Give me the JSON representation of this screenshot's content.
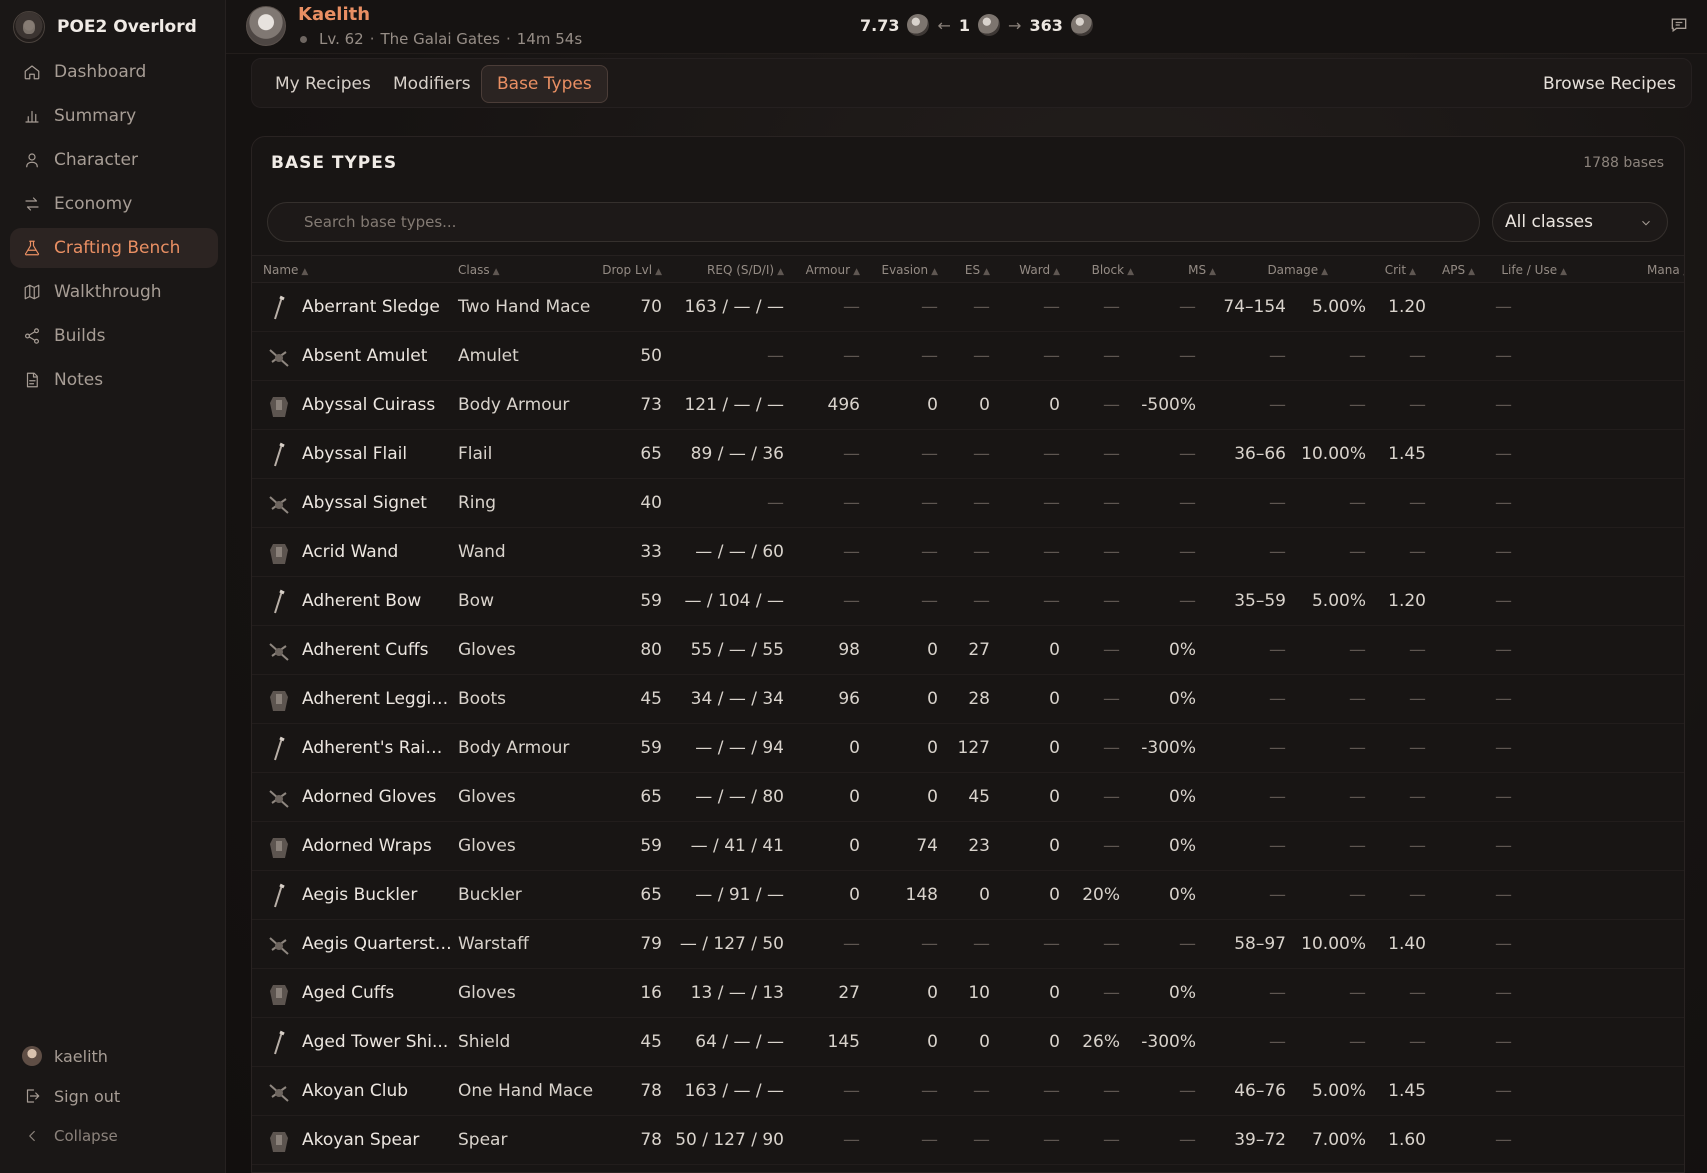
{
  "app": {
    "title": "POE2 Overlord"
  },
  "sidebar": {
    "items": [
      {
        "label": "Dashboard",
        "icon": "home-icon"
      },
      {
        "label": "Summary",
        "icon": "bar-chart-icon"
      },
      {
        "label": "Character",
        "icon": "user-icon"
      },
      {
        "label": "Economy",
        "icon": "swap-icon"
      },
      {
        "label": "Crafting Bench",
        "icon": "flask-icon",
        "active": true
      },
      {
        "label": "Walkthrough",
        "icon": "map-icon"
      },
      {
        "label": "Builds",
        "icon": "share-icon"
      },
      {
        "label": "Notes",
        "icon": "note-icon"
      }
    ],
    "user": "kaelith",
    "sign_out": "Sign out",
    "collapse": "Collapse"
  },
  "character": {
    "name": "Kaelith",
    "level": "Lv. 62",
    "zone": "The Galai Gates",
    "duration": "14m 54s"
  },
  "currency": {
    "ratio": "7.73",
    "one": "1",
    "result": "363"
  },
  "tabs": {
    "my_recipes": "My Recipes",
    "modifiers": "Modifiers",
    "base_types": "Base Types",
    "browse": "Browse Recipes"
  },
  "panel": {
    "title": "BASE TYPES",
    "count": "1788 bases",
    "search_placeholder": "Search base types...",
    "class_filter": "All classes"
  },
  "table": {
    "columns": [
      "Name",
      "Class",
      "Drop Lvl",
      "REQ (S/D/I)",
      "Armour",
      "Evasion",
      "ES",
      "Ward",
      "Block",
      "MS",
      "Damage",
      "Crit",
      "APS",
      "Life / Use",
      "Mana /"
    ],
    "rows": [
      {
        "name": "Aberrant Sledge",
        "class": "Two Hand Mace",
        "drop": "70",
        "req": "163 / — / —",
        "armour": "—",
        "evasion": "—",
        "es": "—",
        "ward": "—",
        "block": "—",
        "ms": "—",
        "damage": "74–154",
        "crit": "5.00%",
        "aps": "1.20",
        "life": "—"
      },
      {
        "name": "Absent Amulet",
        "class": "Amulet",
        "drop": "50",
        "req": "—",
        "armour": "—",
        "evasion": "—",
        "es": "—",
        "ward": "—",
        "block": "—",
        "ms": "—",
        "damage": "—",
        "crit": "—",
        "aps": "—",
        "life": "—"
      },
      {
        "name": "Abyssal Cuirass",
        "class": "Body Armour",
        "drop": "73",
        "req": "121 / — / —",
        "armour": "496",
        "evasion": "0",
        "es": "0",
        "ward": "0",
        "block": "—",
        "ms": "-500%",
        "damage": "—",
        "crit": "—",
        "aps": "—",
        "life": "—"
      },
      {
        "name": "Abyssal Flail",
        "class": "Flail",
        "drop": "65",
        "req": "89 / — / 36",
        "armour": "—",
        "evasion": "—",
        "es": "—",
        "ward": "—",
        "block": "—",
        "ms": "—",
        "damage": "36–66",
        "crit": "10.00%",
        "aps": "1.45",
        "life": "—"
      },
      {
        "name": "Abyssal Signet",
        "class": "Ring",
        "drop": "40",
        "req": "—",
        "armour": "—",
        "evasion": "—",
        "es": "—",
        "ward": "—",
        "block": "—",
        "ms": "—",
        "damage": "—",
        "crit": "—",
        "aps": "—",
        "life": "—"
      },
      {
        "name": "Acrid Wand",
        "class": "Wand",
        "drop": "33",
        "req": "— / — / 60",
        "armour": "—",
        "evasion": "—",
        "es": "—",
        "ward": "—",
        "block": "—",
        "ms": "—",
        "damage": "—",
        "crit": "—",
        "aps": "—",
        "life": "—"
      },
      {
        "name": "Adherent Bow",
        "class": "Bow",
        "drop": "59",
        "req": "— / 104 / —",
        "armour": "—",
        "evasion": "—",
        "es": "—",
        "ward": "—",
        "block": "—",
        "ms": "—",
        "damage": "35–59",
        "crit": "5.00%",
        "aps": "1.20",
        "life": "—"
      },
      {
        "name": "Adherent Cuffs",
        "class": "Gloves",
        "drop": "80",
        "req": "55 / — / 55",
        "armour": "98",
        "evasion": "0",
        "es": "27",
        "ward": "0",
        "block": "—",
        "ms": "0%",
        "damage": "—",
        "crit": "—",
        "aps": "—",
        "life": "—"
      },
      {
        "name": "Adherent Leggin...",
        "class": "Boots",
        "drop": "45",
        "req": "34 / — / 34",
        "armour": "96",
        "evasion": "0",
        "es": "28",
        "ward": "0",
        "block": "—",
        "ms": "0%",
        "damage": "—",
        "crit": "—",
        "aps": "—",
        "life": "—"
      },
      {
        "name": "Adherent's Raim...",
        "class": "Body Armour",
        "drop": "59",
        "req": "— / — / 94",
        "armour": "0",
        "evasion": "0",
        "es": "127",
        "ward": "0",
        "block": "—",
        "ms": "-300%",
        "damage": "—",
        "crit": "—",
        "aps": "—",
        "life": "—"
      },
      {
        "name": "Adorned Gloves",
        "class": "Gloves",
        "drop": "65",
        "req": "— / — / 80",
        "armour": "0",
        "evasion": "0",
        "es": "45",
        "ward": "0",
        "block": "—",
        "ms": "0%",
        "damage": "—",
        "crit": "—",
        "aps": "—",
        "life": "—"
      },
      {
        "name": "Adorned Wraps",
        "class": "Gloves",
        "drop": "59",
        "req": "— / 41 / 41",
        "armour": "0",
        "evasion": "74",
        "es": "23",
        "ward": "0",
        "block": "—",
        "ms": "0%",
        "damage": "—",
        "crit": "—",
        "aps": "—",
        "life": "—"
      },
      {
        "name": "Aegis Buckler",
        "class": "Buckler",
        "drop": "65",
        "req": "— / 91 / —",
        "armour": "0",
        "evasion": "148",
        "es": "0",
        "ward": "0",
        "block": "20%",
        "ms": "0%",
        "damage": "—",
        "crit": "—",
        "aps": "—",
        "life": "—"
      },
      {
        "name": "Aegis Quarterstaff",
        "class": "Warstaff",
        "drop": "79",
        "req": "— / 127 / 50",
        "armour": "—",
        "evasion": "—",
        "es": "—",
        "ward": "—",
        "block": "—",
        "ms": "—",
        "damage": "58–97",
        "crit": "10.00%",
        "aps": "1.40",
        "life": "—"
      },
      {
        "name": "Aged Cuffs",
        "class": "Gloves",
        "drop": "16",
        "req": "13 / — / 13",
        "armour": "27",
        "evasion": "0",
        "es": "10",
        "ward": "0",
        "block": "—",
        "ms": "0%",
        "damage": "—",
        "crit": "—",
        "aps": "—",
        "life": "—"
      },
      {
        "name": "Aged Tower Shi...",
        "class": "Shield",
        "drop": "45",
        "req": "64 / — / —",
        "armour": "145",
        "evasion": "0",
        "es": "0",
        "ward": "0",
        "block": "26%",
        "ms": "-300%",
        "damage": "—",
        "crit": "—",
        "aps": "—",
        "life": "—"
      },
      {
        "name": "Akoyan Club",
        "class": "One Hand Mace",
        "drop": "78",
        "req": "163 / — / —",
        "armour": "—",
        "evasion": "—",
        "es": "—",
        "ward": "—",
        "block": "—",
        "ms": "—",
        "damage": "46–76",
        "crit": "5.00%",
        "aps": "1.45",
        "life": "—"
      },
      {
        "name": "Akoyan Spear",
        "class": "Spear",
        "drop": "78",
        "req": "50 / 127 / 90",
        "armour": "—",
        "evasion": "—",
        "es": "—",
        "ward": "—",
        "block": "—",
        "ms": "—",
        "damage": "39–72",
        "crit": "7.00%",
        "aps": "1.60",
        "life": "—"
      }
    ]
  }
}
